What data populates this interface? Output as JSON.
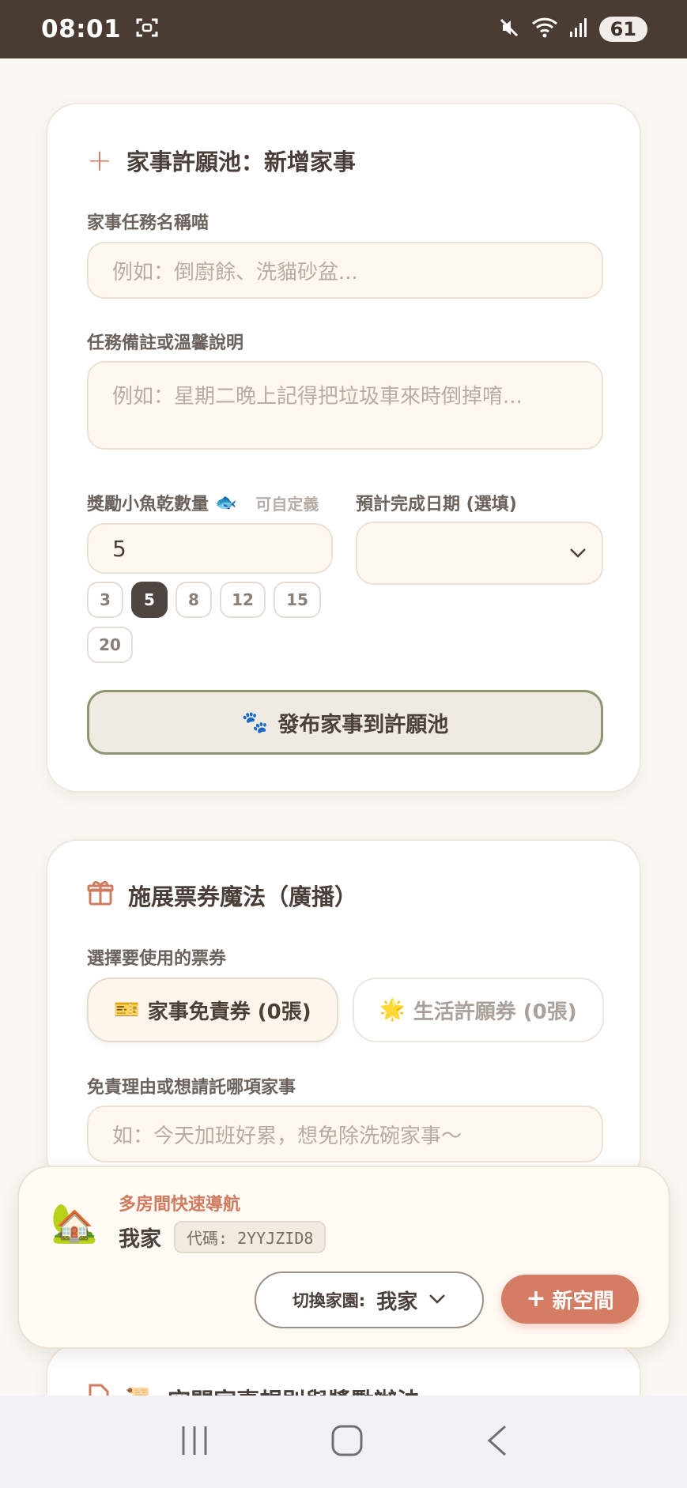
{
  "status_bar": {
    "time": "08:01",
    "battery": "61"
  },
  "add_chore": {
    "title": "家事許願池：新增家事",
    "task_name_label": "家事任務名稱喵",
    "task_name_placeholder": "例如：倒廚餘、洗貓砂盆...",
    "note_label": "任務備註或溫馨說明",
    "note_placeholder": "例如：星期二晚上記得把垃圾車來時倒掉唷...",
    "reward_label": "獎勵小魚乾數量",
    "reward_icon": "🐟",
    "reward_hint": "可自定義",
    "reward_value": "5",
    "reward_presets": [
      "3",
      "5",
      "8",
      "12",
      "15",
      "20"
    ],
    "reward_selected": "5",
    "due_date_label": "預計完成日期 (選填)",
    "publish_icon": "🐾",
    "publish_label": "發布家事到許願池"
  },
  "ticket_magic": {
    "title": "施展票券魔法（廣播）",
    "select_label": "選擇要使用的票券",
    "ticket_chore_icon": "🎫",
    "ticket_chore_label": "家事免責券 (0張)",
    "ticket_wish_icon": "🌟",
    "ticket_wish_label": "生活許願券 (0張)",
    "reason_label": "免責理由或想請託哪項家事",
    "reason_placeholder": "如：今天加班好累，想免除洗碗家事～"
  },
  "rules_card": {
    "title_icon": "📜",
    "title": "空間家事規則與獎勵辦法"
  },
  "room_nav": {
    "icon": "🏡",
    "title": "多房間快速導航",
    "home_name": "我家",
    "code": "代碼: 2YYJZID8",
    "switch_label": "切換家園:",
    "switch_value": "我家",
    "new_space_label": "新空間"
  },
  "colors": {
    "accent": "#d47c64",
    "status_bar": "#4a3c33",
    "background": "#faf8f3"
  }
}
